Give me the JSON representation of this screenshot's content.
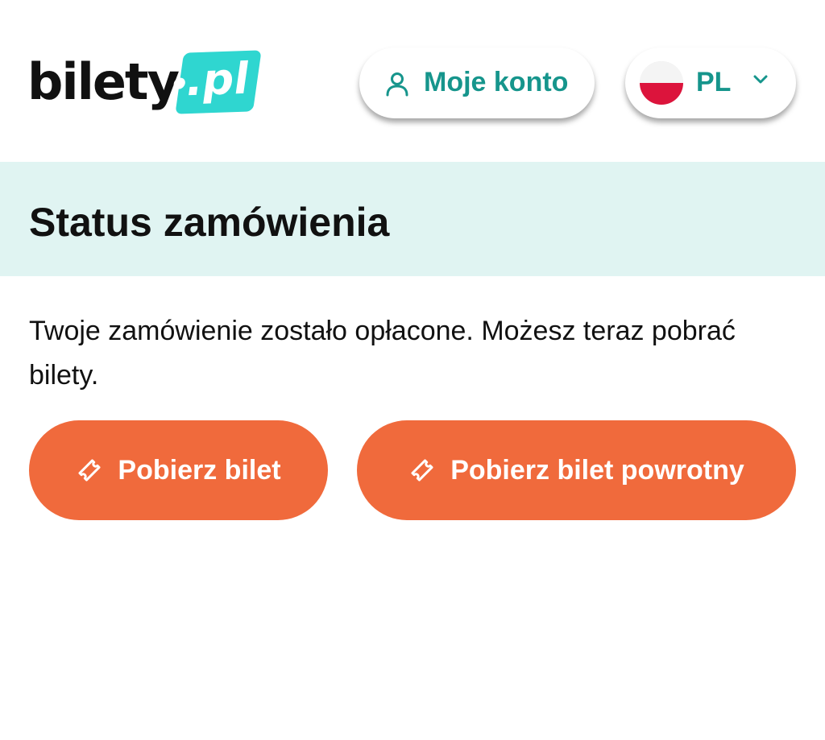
{
  "header": {
    "logo": {
      "text": "bilety",
      "badge": ".pl"
    },
    "account_button": {
      "label": "Moje konto",
      "icon": "user-icon"
    },
    "language_selector": {
      "label": "PL",
      "flag": "poland-flag-icon",
      "icon": "chevron-down-icon"
    }
  },
  "banner": {
    "title": "Status zamówienia"
  },
  "main": {
    "message": "Twoje zamówienie zostało opłacone. Możesz teraz pobrać bilety.",
    "buttons": [
      {
        "label": "Pobierz bilet",
        "icon": "ticket-icon"
      },
      {
        "label": "Pobierz bilet powrotny",
        "icon": "ticket-icon"
      }
    ]
  },
  "colors": {
    "brand_teal": "#16958c",
    "logo_badge": "#2fd6d0",
    "banner_bg": "#e0f4f2",
    "primary_button": "#f06a3c",
    "text": "#111111"
  }
}
